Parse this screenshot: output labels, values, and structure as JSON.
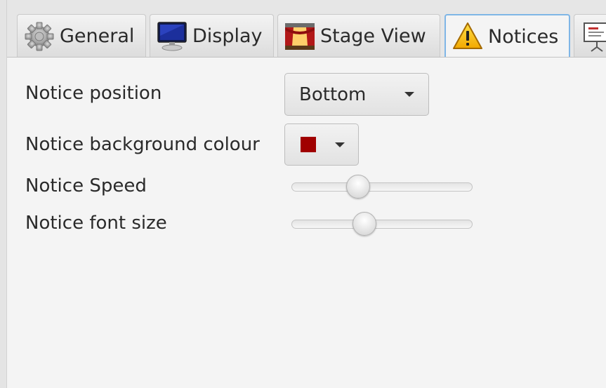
{
  "tabs": [
    {
      "label": "General",
      "icon": "gear-icon",
      "active": false
    },
    {
      "label": "Display",
      "icon": "monitor-icon",
      "active": false
    },
    {
      "label": "Stage View",
      "icon": "stage-icon",
      "active": false
    },
    {
      "label": "Notices",
      "icon": "warning-icon",
      "active": true
    },
    {
      "label": "",
      "icon": "presentation-icon",
      "active": false
    }
  ],
  "notices": {
    "position_label": "Notice position",
    "position_value": "Bottom",
    "background_label": "Notice background colour",
    "background_color": "#a00000",
    "speed_label": "Notice Speed",
    "speed_value": 0.35,
    "font_size_label": "Notice font size",
    "font_size_value": 0.39
  }
}
